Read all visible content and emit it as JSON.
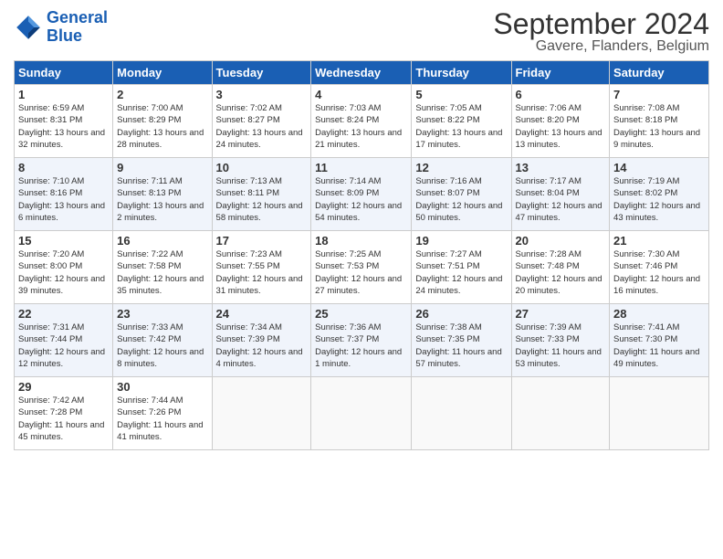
{
  "logo": {
    "line1": "General",
    "line2": "Blue"
  },
  "title": "September 2024",
  "location": "Gavere, Flanders, Belgium",
  "headers": [
    "Sunday",
    "Monday",
    "Tuesday",
    "Wednesday",
    "Thursday",
    "Friday",
    "Saturday"
  ],
  "weeks": [
    [
      {
        "day": "1",
        "sunrise": "Sunrise: 6:59 AM",
        "sunset": "Sunset: 8:31 PM",
        "daylight": "Daylight: 13 hours and 32 minutes."
      },
      {
        "day": "2",
        "sunrise": "Sunrise: 7:00 AM",
        "sunset": "Sunset: 8:29 PM",
        "daylight": "Daylight: 13 hours and 28 minutes."
      },
      {
        "day": "3",
        "sunrise": "Sunrise: 7:02 AM",
        "sunset": "Sunset: 8:27 PM",
        "daylight": "Daylight: 13 hours and 24 minutes."
      },
      {
        "day": "4",
        "sunrise": "Sunrise: 7:03 AM",
        "sunset": "Sunset: 8:24 PM",
        "daylight": "Daylight: 13 hours and 21 minutes."
      },
      {
        "day": "5",
        "sunrise": "Sunrise: 7:05 AM",
        "sunset": "Sunset: 8:22 PM",
        "daylight": "Daylight: 13 hours and 17 minutes."
      },
      {
        "day": "6",
        "sunrise": "Sunrise: 7:06 AM",
        "sunset": "Sunset: 8:20 PM",
        "daylight": "Daylight: 13 hours and 13 minutes."
      },
      {
        "day": "7",
        "sunrise": "Sunrise: 7:08 AM",
        "sunset": "Sunset: 8:18 PM",
        "daylight": "Daylight: 13 hours and 9 minutes."
      }
    ],
    [
      {
        "day": "8",
        "sunrise": "Sunrise: 7:10 AM",
        "sunset": "Sunset: 8:16 PM",
        "daylight": "Daylight: 13 hours and 6 minutes."
      },
      {
        "day": "9",
        "sunrise": "Sunrise: 7:11 AM",
        "sunset": "Sunset: 8:13 PM",
        "daylight": "Daylight: 13 hours and 2 minutes."
      },
      {
        "day": "10",
        "sunrise": "Sunrise: 7:13 AM",
        "sunset": "Sunset: 8:11 PM",
        "daylight": "Daylight: 12 hours and 58 minutes."
      },
      {
        "day": "11",
        "sunrise": "Sunrise: 7:14 AM",
        "sunset": "Sunset: 8:09 PM",
        "daylight": "Daylight: 12 hours and 54 minutes."
      },
      {
        "day": "12",
        "sunrise": "Sunrise: 7:16 AM",
        "sunset": "Sunset: 8:07 PM",
        "daylight": "Daylight: 12 hours and 50 minutes."
      },
      {
        "day": "13",
        "sunrise": "Sunrise: 7:17 AM",
        "sunset": "Sunset: 8:04 PM",
        "daylight": "Daylight: 12 hours and 47 minutes."
      },
      {
        "day": "14",
        "sunrise": "Sunrise: 7:19 AM",
        "sunset": "Sunset: 8:02 PM",
        "daylight": "Daylight: 12 hours and 43 minutes."
      }
    ],
    [
      {
        "day": "15",
        "sunrise": "Sunrise: 7:20 AM",
        "sunset": "Sunset: 8:00 PM",
        "daylight": "Daylight: 12 hours and 39 minutes."
      },
      {
        "day": "16",
        "sunrise": "Sunrise: 7:22 AM",
        "sunset": "Sunset: 7:58 PM",
        "daylight": "Daylight: 12 hours and 35 minutes."
      },
      {
        "day": "17",
        "sunrise": "Sunrise: 7:23 AM",
        "sunset": "Sunset: 7:55 PM",
        "daylight": "Daylight: 12 hours and 31 minutes."
      },
      {
        "day": "18",
        "sunrise": "Sunrise: 7:25 AM",
        "sunset": "Sunset: 7:53 PM",
        "daylight": "Daylight: 12 hours and 27 minutes."
      },
      {
        "day": "19",
        "sunrise": "Sunrise: 7:27 AM",
        "sunset": "Sunset: 7:51 PM",
        "daylight": "Daylight: 12 hours and 24 minutes."
      },
      {
        "day": "20",
        "sunrise": "Sunrise: 7:28 AM",
        "sunset": "Sunset: 7:48 PM",
        "daylight": "Daylight: 12 hours and 20 minutes."
      },
      {
        "day": "21",
        "sunrise": "Sunrise: 7:30 AM",
        "sunset": "Sunset: 7:46 PM",
        "daylight": "Daylight: 12 hours and 16 minutes."
      }
    ],
    [
      {
        "day": "22",
        "sunrise": "Sunrise: 7:31 AM",
        "sunset": "Sunset: 7:44 PM",
        "daylight": "Daylight: 12 hours and 12 minutes."
      },
      {
        "day": "23",
        "sunrise": "Sunrise: 7:33 AM",
        "sunset": "Sunset: 7:42 PM",
        "daylight": "Daylight: 12 hours and 8 minutes."
      },
      {
        "day": "24",
        "sunrise": "Sunrise: 7:34 AM",
        "sunset": "Sunset: 7:39 PM",
        "daylight": "Daylight: 12 hours and 4 minutes."
      },
      {
        "day": "25",
        "sunrise": "Sunrise: 7:36 AM",
        "sunset": "Sunset: 7:37 PM",
        "daylight": "Daylight: 12 hours and 1 minute."
      },
      {
        "day": "26",
        "sunrise": "Sunrise: 7:38 AM",
        "sunset": "Sunset: 7:35 PM",
        "daylight": "Daylight: 11 hours and 57 minutes."
      },
      {
        "day": "27",
        "sunrise": "Sunrise: 7:39 AM",
        "sunset": "Sunset: 7:33 PM",
        "daylight": "Daylight: 11 hours and 53 minutes."
      },
      {
        "day": "28",
        "sunrise": "Sunrise: 7:41 AM",
        "sunset": "Sunset: 7:30 PM",
        "daylight": "Daylight: 11 hours and 49 minutes."
      }
    ],
    [
      {
        "day": "29",
        "sunrise": "Sunrise: 7:42 AM",
        "sunset": "Sunset: 7:28 PM",
        "daylight": "Daylight: 11 hours and 45 minutes."
      },
      {
        "day": "30",
        "sunrise": "Sunrise: 7:44 AM",
        "sunset": "Sunset: 7:26 PM",
        "daylight": "Daylight: 11 hours and 41 minutes."
      },
      {
        "day": "",
        "sunrise": "",
        "sunset": "",
        "daylight": ""
      },
      {
        "day": "",
        "sunrise": "",
        "sunset": "",
        "daylight": ""
      },
      {
        "day": "",
        "sunrise": "",
        "sunset": "",
        "daylight": ""
      },
      {
        "day": "",
        "sunrise": "",
        "sunset": "",
        "daylight": ""
      },
      {
        "day": "",
        "sunrise": "",
        "sunset": "",
        "daylight": ""
      }
    ]
  ]
}
